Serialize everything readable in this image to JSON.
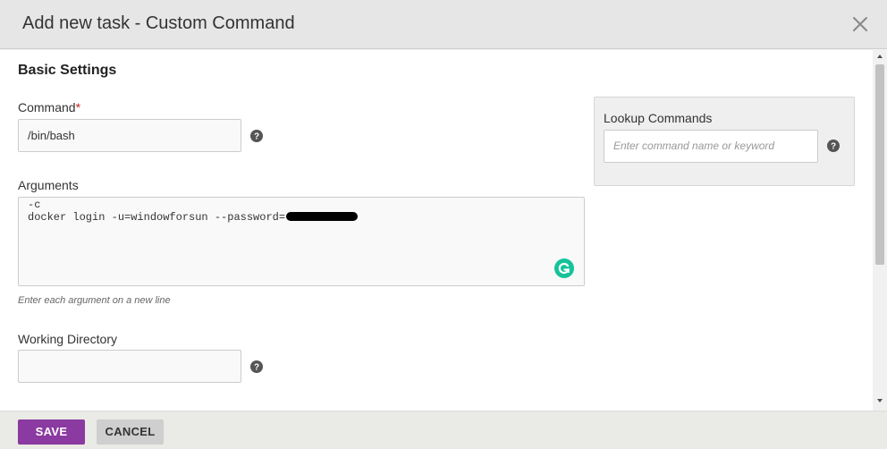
{
  "dialog": {
    "title": "Add new task - Custom Command"
  },
  "basic_settings": {
    "title": "Basic Settings",
    "command": {
      "label": "Command",
      "required_mark": "*",
      "value": "/bin/bash"
    },
    "arguments": {
      "label": "Arguments",
      "lines": [
        "-c",
        "docker login -u=windowforsun --password="
      ],
      "hint": "Enter each argument on a new line"
    },
    "working_directory": {
      "label": "Working Directory",
      "value": ""
    }
  },
  "lookup": {
    "title": "Lookup Commands",
    "placeholder": "Enter command name or keyword"
  },
  "footer": {
    "save_label": "SAVE",
    "cancel_label": "CANCEL"
  },
  "colors": {
    "save_button": "#8a3aa0",
    "grammarly": "#15c39a",
    "required": "#cc2222"
  }
}
